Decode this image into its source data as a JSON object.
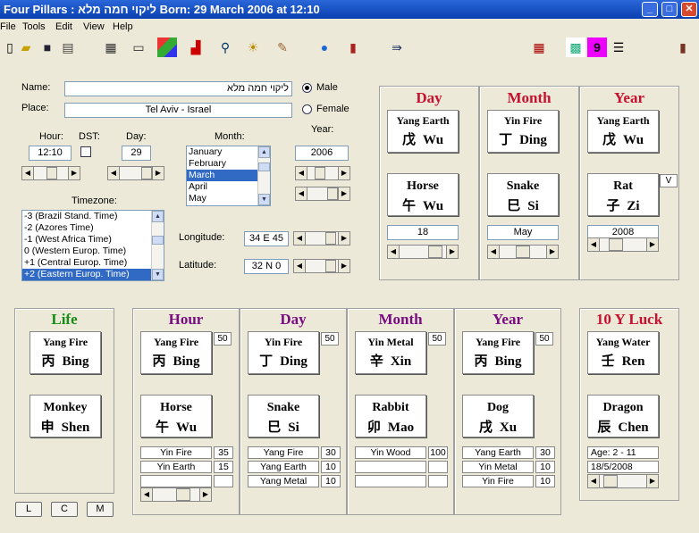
{
  "window": {
    "title": "Four Pillars : ליקוי חמה מלא   Born:  29 March 2006 at 12:10",
    "min": "_",
    "max": "□",
    "close": "✕"
  },
  "menu": [
    "File",
    "Tools",
    "Edit",
    "View",
    "Help"
  ],
  "form": {
    "name_label": "Name:",
    "name_value": "ליקוי חמה מלא",
    "place_label": "Place:",
    "place_value": "Tel Aviv - Israel",
    "male_label": "Male",
    "female_label": "Female",
    "hour_label": "Hour:",
    "hour_value": "12:10",
    "dst_label": "DST:",
    "day_label": "Day:",
    "day_value": "29",
    "month_label": "Month:",
    "months": [
      "January",
      "February",
      "March",
      "April",
      "May"
    ],
    "month_selected": "March",
    "year_label": "Year:",
    "year_value": "2006",
    "timezone_label": "Timezone:",
    "timezones": [
      "-3 (Brazil Stand.  Time)",
      "-2 (Azores Time)",
      "-1 (West Africa Time)",
      "0 (Western Europ. Time)",
      "+1 (Central Europ. Time)",
      "+2 (Eastern Europ. Time)"
    ],
    "timezone_selected": "+2 (Eastern Europ. Time)",
    "longitude_label": "Longitude:",
    "longitude_value": "34 E 45",
    "latitude_label": "Latitude:",
    "latitude_value": "32 N 0"
  },
  "top_pillars": [
    {
      "title": "Day",
      "stem": "Yang Earth",
      "stem_cn": "戊",
      "stem_py": "Wu",
      "branch": "Horse",
      "branch_cn": "午",
      "branch_py": "Wu",
      "value": "18"
    },
    {
      "title": "Month",
      "stem": "Yin Fire",
      "stem_cn": "丁",
      "stem_py": "Ding",
      "branch": "Snake",
      "branch_cn": "巳",
      "branch_py": "Si",
      "value": "May"
    },
    {
      "title": "Year",
      "stem": "Yang Earth",
      "stem_cn": "戊",
      "stem_py": "Wu",
      "branch": "Rat",
      "branch_cn": "子",
      "branch_py": "Zi",
      "value": "2008",
      "badge": "V"
    }
  ],
  "life": {
    "title": "Life",
    "stem": "Yang Fire",
    "stem_cn": "丙",
    "stem_py": "Bing",
    "branch": "Monkey",
    "branch_cn": "申",
    "branch_py": "Shen",
    "buttons": [
      "L",
      "C",
      "M"
    ]
  },
  "natal_pillars": [
    {
      "title": "Hour",
      "stem": "Yang Fire",
      "stem_cn": "丙",
      "stem_py": "Bing",
      "score": "50",
      "branch": "Horse",
      "branch_cn": "午",
      "branch_py": "Wu",
      "hidden": [
        {
          "name": "Yin Fire",
          "val": "35"
        },
        {
          "name": "Yin Earth",
          "val": "15"
        },
        {
          "name": "",
          "val": ""
        }
      ]
    },
    {
      "title": "Day",
      "stem": "Yin Fire",
      "stem_cn": "丁",
      "stem_py": "Ding",
      "score": "50",
      "branch": "Snake",
      "branch_cn": "巳",
      "branch_py": "Si",
      "hidden": [
        {
          "name": "Yang Fire",
          "val": "30"
        },
        {
          "name": "Yang Earth",
          "val": "10"
        },
        {
          "name": "Yang Metal",
          "val": "10"
        }
      ]
    },
    {
      "title": "Month",
      "stem": "Yin Metal",
      "stem_cn": "辛",
      "stem_py": "Xin",
      "score": "50",
      "branch": "Rabbit",
      "branch_cn": "卯",
      "branch_py": "Mao",
      "hidden": [
        {
          "name": "Yin Wood",
          "val": "100"
        },
        {
          "name": "",
          "val": ""
        },
        {
          "name": "",
          "val": ""
        }
      ]
    },
    {
      "title": "Year",
      "stem": "Yang Fire",
      "stem_cn": "丙",
      "stem_py": "Bing",
      "score": "50",
      "branch": "Dog",
      "branch_cn": "戌",
      "branch_py": "Xu",
      "hidden": [
        {
          "name": "Yang Earth",
          "val": "30"
        },
        {
          "name": "Yin Metal",
          "val": "10"
        },
        {
          "name": "Yin Fire",
          "val": "10"
        }
      ]
    }
  ],
  "luck": {
    "title": "10 Y Luck",
    "stem": "Yang Water",
    "stem_cn": "壬",
    "stem_py": "Ren",
    "branch": "Dragon",
    "branch_cn": "辰",
    "branch_py": "Chen",
    "age": "Age: 2 - 11",
    "date": "18/5/2008"
  },
  "colors": {
    "title_red": "#c8102e",
    "title_purple": "#7a0c82",
    "title_green": "#178c17",
    "selection": "#316ac5"
  }
}
